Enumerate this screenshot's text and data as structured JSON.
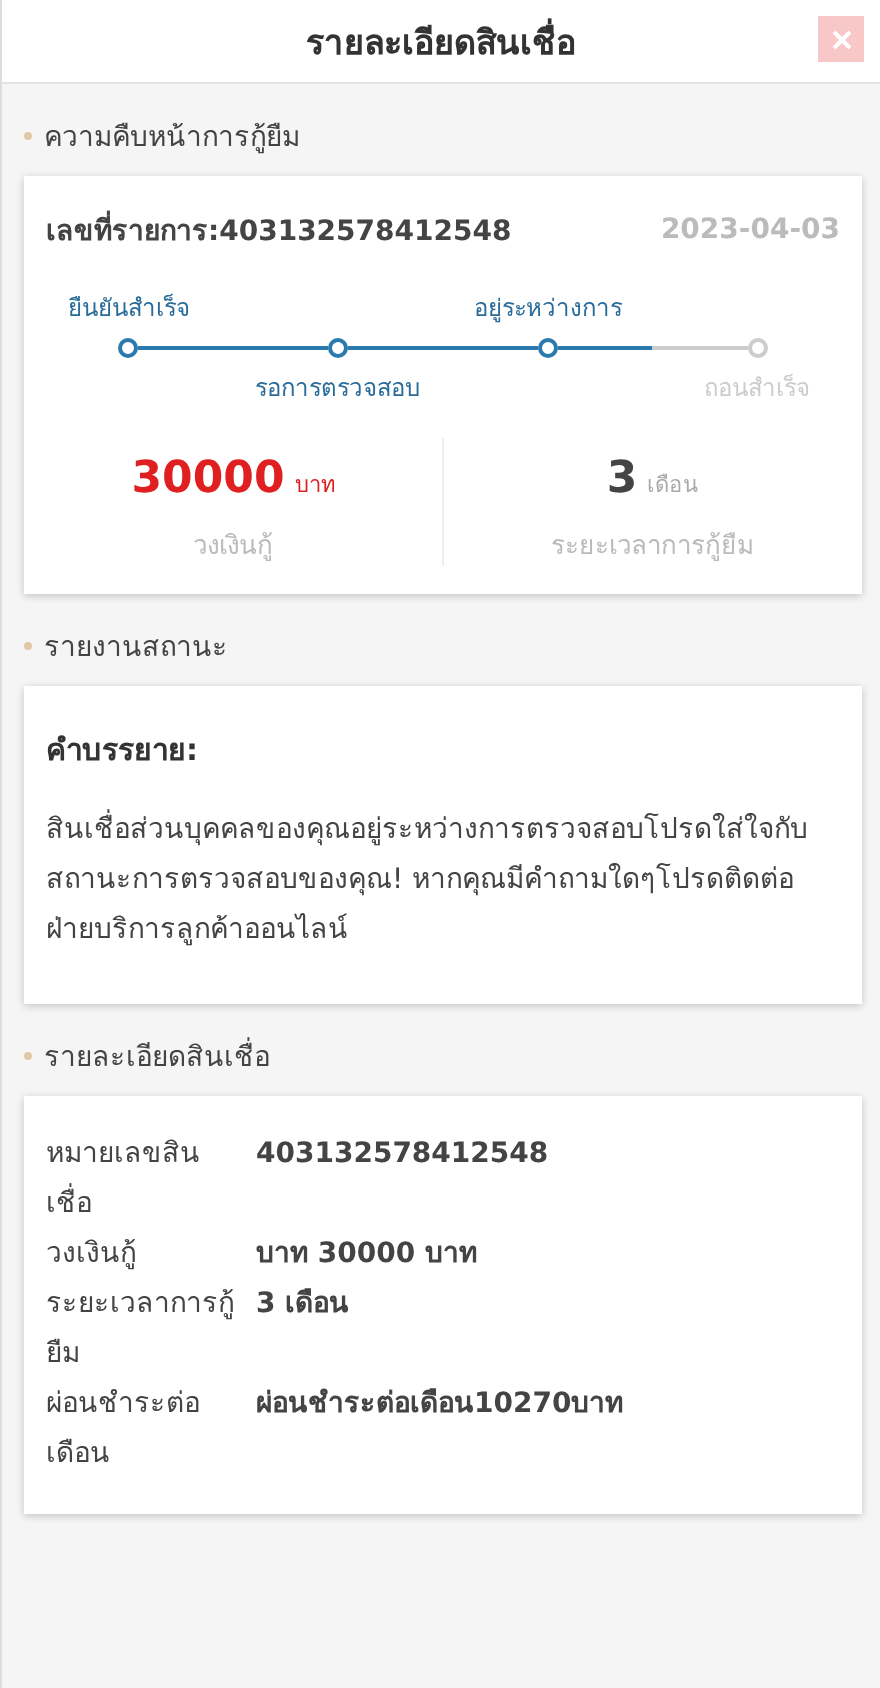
{
  "header": {
    "title": "รายละเอียดสินเชื่อ"
  },
  "progress_section": {
    "title": "ความคืบหน้าการกู้ยืม",
    "order_label": "เลขที่รายการ:403132578412548",
    "date": "2023-04-03",
    "steps": [
      {
        "label": "ยืนยันสำเร็จ",
        "done": true
      },
      {
        "label": "รอการตรวจสอบ",
        "done": true
      },
      {
        "label": "อยู่ระหว่างการ",
        "done": true
      },
      {
        "label": "ถอนสำเร็จ",
        "done": false
      }
    ],
    "amount": {
      "value": "30000",
      "unit": "บาท",
      "label": "วงเงินกู้"
    },
    "term": {
      "value": "3",
      "unit": "เดือน",
      "label": "ระยะเวลาการกู้ยืม"
    }
  },
  "status_section": {
    "title": "รายงานสถานะ",
    "heading": "คำบรรยาย:",
    "text": "สินเชื่อส่วนบุคคลของคุณอยู่ระหว่างการตรวจสอบโปรดใส่ใจกับสถานะการตรวจสอบของคุณ! หากคุณมีคำถามใดๆโปรดติดต่อฝ่ายบริการลูกค้าออนไลน์"
  },
  "details_section": {
    "title": "รายละเอียดสินเชื่อ",
    "rows": [
      {
        "label": "หมายเลขสินเชื่อ",
        "value": "403132578412548"
      },
      {
        "label": "วงเงินกู้",
        "value": "บาท 30000 บาท"
      },
      {
        "label": "ระยะเวลาการกู้ยืม",
        "value": "3 เดือน"
      },
      {
        "label": "ผ่อนชำระต่อเดือน",
        "value": "ผ่อนชำระต่อเดือน10270บาท"
      }
    ]
  }
}
